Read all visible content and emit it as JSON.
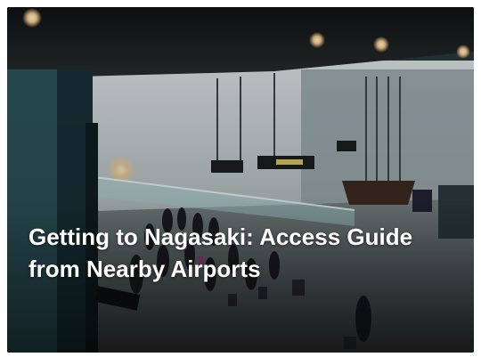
{
  "article": {
    "title": "Getting to Nagasaki: Access Guide from Nearby Airports",
    "image_subject": "airport-terminal-photo"
  },
  "colors": {
    "title_text": "#ffffff",
    "ceiling": "#1b1f21",
    "wall": "#c9d1d3",
    "floor": "#5a6466",
    "pillar": "#1f4148",
    "light": "#f3c98a"
  }
}
